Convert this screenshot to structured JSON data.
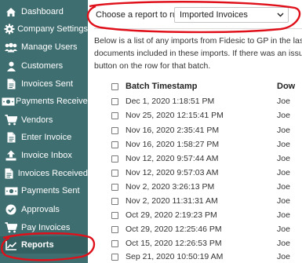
{
  "sidebar": {
    "items": [
      {
        "label": "Dashboard",
        "icon": "home-icon"
      },
      {
        "label": "Company Settings",
        "icon": "gear-icon"
      },
      {
        "label": "Manage Users",
        "icon": "users-icon"
      },
      {
        "label": "Customers",
        "icon": "user-icon"
      },
      {
        "label": "Invoices Sent",
        "icon": "document-icon"
      },
      {
        "label": "Payments Received",
        "icon": "money-icon"
      },
      {
        "label": "Vendors",
        "icon": "cart-icon"
      },
      {
        "label": "Enter Invoice",
        "icon": "document-icon"
      },
      {
        "label": "Invoice Inbox",
        "icon": "upload-icon"
      },
      {
        "label": "Invoices Received",
        "icon": "document-icon"
      },
      {
        "label": "Payments Sent",
        "icon": "money-icon"
      },
      {
        "label": "Approvals",
        "icon": "check-circle-icon"
      },
      {
        "label": "Pay Invoices",
        "icon": "cart-icon"
      },
      {
        "label": "Reports",
        "icon": "chart-icon"
      }
    ]
  },
  "report": {
    "prompt": "Choose a report to run:",
    "selected": "Imported Invoices"
  },
  "description": {
    "line1": "Below is a list of any imports from Fidesic to GP in the last y",
    "line2": "documents included in these imports. If there was an issue",
    "line3": "button on the row for that batch."
  },
  "table": {
    "headers": {
      "timestamp": "Batch Timestamp",
      "user": "Dow"
    },
    "rows": [
      {
        "timestamp": "Dec 1, 2020 1:18:51 PM",
        "user": "Joe"
      },
      {
        "timestamp": "Nov 25, 2020 12:15:41 PM",
        "user": "Joe"
      },
      {
        "timestamp": "Nov 16, 2020 2:35:41 PM",
        "user": "Joe"
      },
      {
        "timestamp": "Nov 16, 2020 1:58:27 PM",
        "user": "Joe"
      },
      {
        "timestamp": "Nov 12, 2020 9:57:44 AM",
        "user": "Joe"
      },
      {
        "timestamp": "Nov 12, 2020 9:57:03 AM",
        "user": "Joe"
      },
      {
        "timestamp": "Nov 2, 2020 3:26:13 PM",
        "user": "Joe"
      },
      {
        "timestamp": "Nov 2, 2020 11:31:31 AM",
        "user": "Joe"
      },
      {
        "timestamp": "Oct 29, 2020 2:19:23 PM",
        "user": "Joe"
      },
      {
        "timestamp": "Oct 29, 2020 12:25:46 PM",
        "user": "Joe"
      },
      {
        "timestamp": "Oct 15, 2020 12:26:53 PM",
        "user": "Joe"
      },
      {
        "timestamp": "Sep 21, 2020 10:50:19 AM",
        "user": "Joe"
      }
    ]
  },
  "colors": {
    "sidebar": "#3f6e70",
    "annotation": "#e0101a"
  }
}
